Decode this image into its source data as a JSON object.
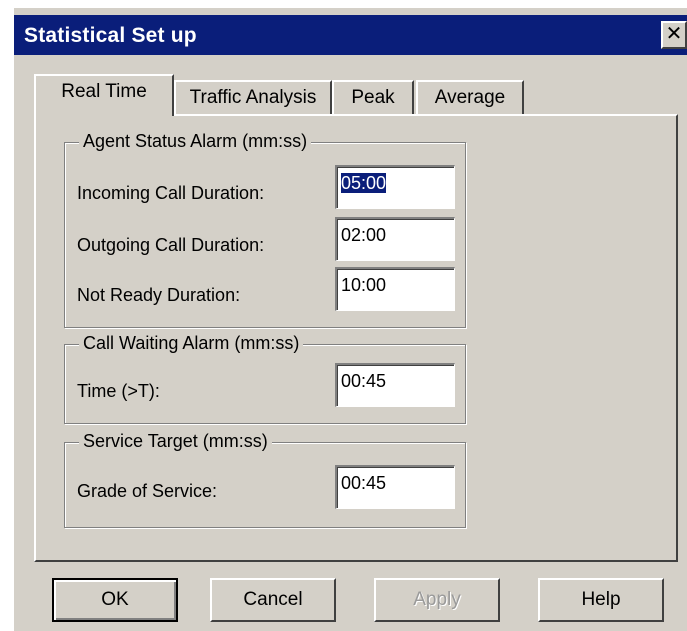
{
  "window": {
    "title": "Statistical Set up",
    "close_glyph": "✕",
    "close_icon": "close-icon",
    "colors": {
      "titlebar": "#0a1e7a",
      "face": "#d4d0c8"
    }
  },
  "tabs": [
    {
      "label": "Real Time",
      "active": true
    },
    {
      "label": "Traffic Analysis",
      "active": false
    },
    {
      "label": "Peak",
      "active": false
    },
    {
      "label": "Average",
      "active": false
    }
  ],
  "agent_status": {
    "title": "Agent Status Alarm (mm:ss)",
    "incoming": {
      "label": "Incoming Call Duration:",
      "value": "05:00"
    },
    "outgoing": {
      "label": "Outgoing Call Duration:",
      "value": "02:00"
    },
    "not_ready": {
      "label": "Not Ready Duration:",
      "value": "10:00"
    }
  },
  "call_waiting": {
    "title": "Call Waiting Alarm (mm:ss)",
    "time": {
      "label": "Time (>T):",
      "value": "00:45"
    }
  },
  "service_target": {
    "title": "Service Target (mm:ss)",
    "grade": {
      "label": "Grade of Service:",
      "value": "00:45"
    }
  },
  "buttons": {
    "ok": "OK",
    "cancel": "Cancel",
    "apply": "Apply",
    "help": "Help"
  }
}
